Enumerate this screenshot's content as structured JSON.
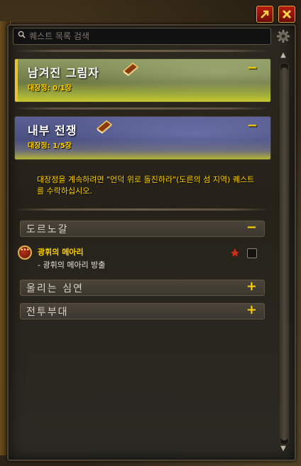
{
  "search": {
    "placeholder": "퀘스트 목록 검색"
  },
  "window_buttons": {
    "expand_icon": "arrow-up-right-icon",
    "close_icon": "close-icon"
  },
  "campaigns": [
    {
      "title": "남겨진 그림자",
      "progress_label": "대장정: 0/1장",
      "chapters_done": 0,
      "chapters_total": 1,
      "toggle": "−",
      "icon": "book-icon",
      "color": "#8d9a62"
    },
    {
      "title": "내부 전쟁",
      "progress_label": "대장정: 1/5장",
      "chapters_done": 1,
      "chapters_total": 5,
      "toggle": "−",
      "icon": "book-icon",
      "color": "#5b5f94"
    }
  ],
  "hint_text": "대장정을 계속하려면 \"언덕 위로 돌진하라\"(도른의 섬 지역) 퀘스트를 수락하십시오.",
  "zones": [
    {
      "label": "도르노갈",
      "toggle": "−",
      "expanded": true
    },
    {
      "label": "울리는 심연",
      "toggle": "+",
      "expanded": false
    },
    {
      "label": "전투부대",
      "toggle": "+",
      "expanded": false
    }
  ],
  "quest": {
    "title": "광휘의 메아리",
    "objective": "- 광휘의 메아리 방출",
    "tracked": false
  },
  "colors": {
    "accent_yellow": "#ffd100",
    "close_red": "#b51c0c"
  }
}
